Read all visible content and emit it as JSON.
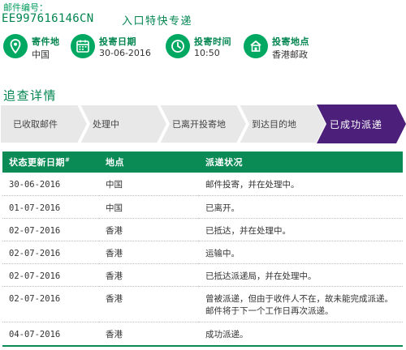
{
  "header": {
    "mail_label": "邮件编号：",
    "tracking_number": "EE997616146CN",
    "service_name": "入口特快专递"
  },
  "info": [
    {
      "icon": "location-pin-icon",
      "title": "寄件地",
      "value": "中国"
    },
    {
      "icon": "calendar-icon",
      "title": "投寄日期",
      "value": "30-06-2016"
    },
    {
      "icon": "clock-icon",
      "title": "投寄时间",
      "value": "10:50"
    },
    {
      "icon": "post-office-icon",
      "title": "投寄地点",
      "value": "香港邮政"
    }
  ],
  "section_title": "追查详情",
  "steps": [
    {
      "label": "已收取邮件",
      "active": false
    },
    {
      "label": "处理中",
      "active": false
    },
    {
      "label": "已离开投寄地",
      "active": false
    },
    {
      "label": "到达目的地",
      "active": false
    },
    {
      "label": "已成功派递",
      "active": true
    }
  ],
  "colors": {
    "brand_green": "#0a8a55",
    "active_step": "#4b1f7a",
    "inactive_step": "#e8e8e8"
  },
  "table": {
    "headers": {
      "date": "状态更新日期",
      "date_mark": "#",
      "location": "地点",
      "status": "派递状况"
    },
    "rows": [
      {
        "date": "30-06-2016",
        "location": "中国",
        "status": "邮件投寄，并在处理中。"
      },
      {
        "date": "01-07-2016",
        "location": "中国",
        "status": "已离开。"
      },
      {
        "date": "02-07-2016",
        "location": "香港",
        "status": "已抵达，并在处理中。"
      },
      {
        "date": "02-07-2016",
        "location": "香港",
        "status": "运输中。"
      },
      {
        "date": "02-07-2016",
        "location": "香港",
        "status": "已抵达派递局，并在处理中。"
      },
      {
        "date": "02-07-2016",
        "location": "香港",
        "status": "曾被派递，但由于收件人不在，故未能完成派递。邮件将于下一个工作日再次派递。"
      },
      {
        "date": "04-07-2016",
        "location": "香港",
        "status": "成功派递。"
      }
    ]
  }
}
